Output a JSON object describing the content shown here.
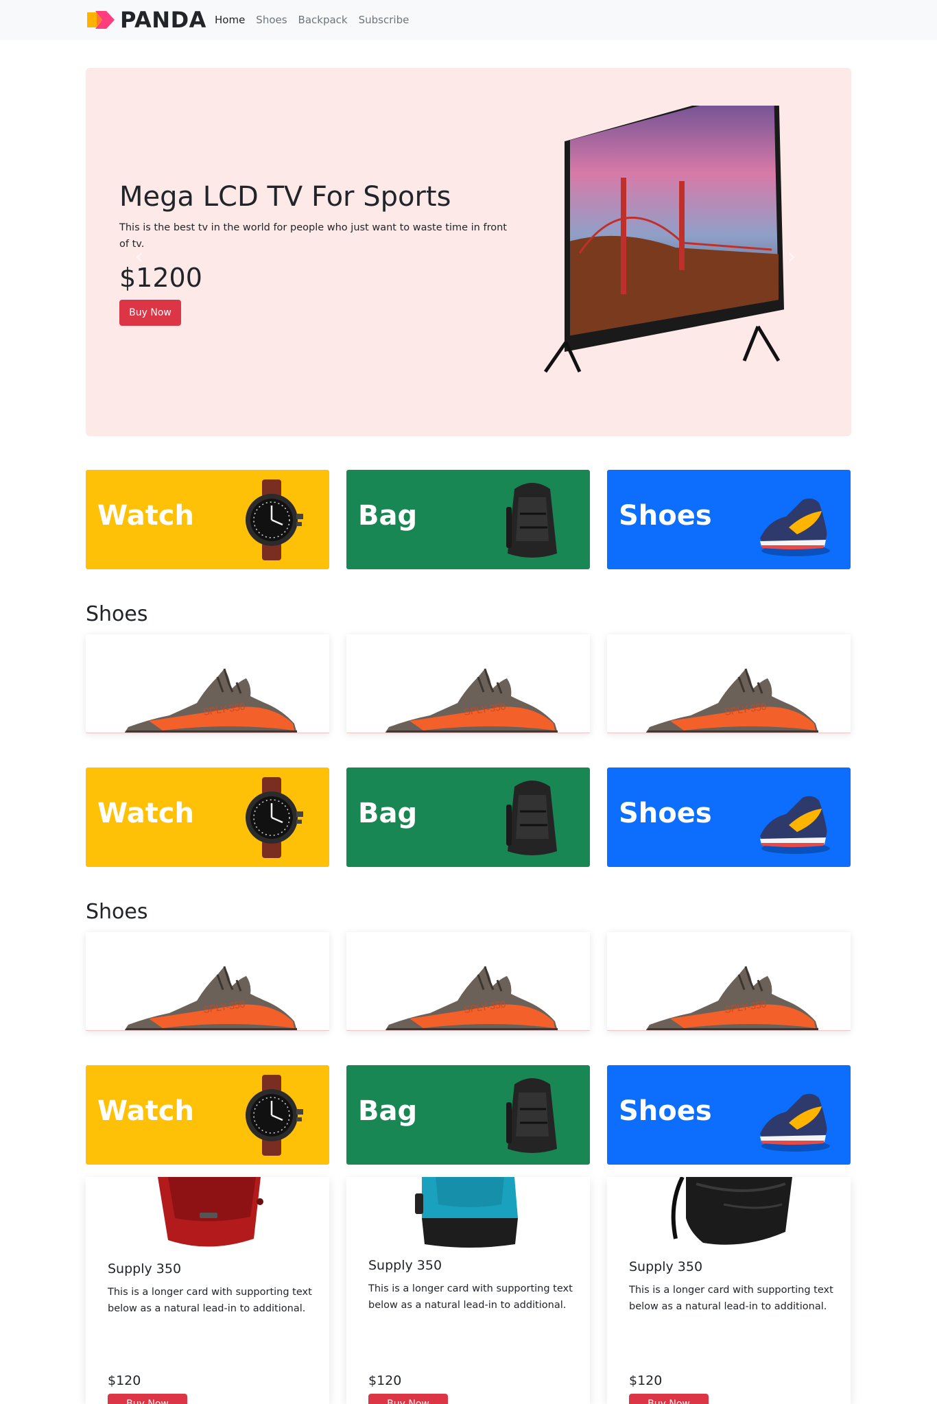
{
  "navbar": {
    "brand": "PANDA",
    "links": [
      {
        "label": "Home",
        "active": true
      },
      {
        "label": "Shoes",
        "active": false
      },
      {
        "label": "Backpack",
        "active": false
      },
      {
        "label": "Subscribe",
        "active": false
      }
    ]
  },
  "hero": {
    "title": "Mega LCD TV For Sports",
    "description": "This is the best tv in the world for people who just want to waste time in front of tv.",
    "price": "$1200",
    "button": "Buy Now",
    "prev_icon": "chevron-left-icon",
    "next_icon": "chevron-right-icon"
  },
  "categories": [
    {
      "label": "Watch",
      "color": "#ffc107",
      "icon": "watch-icon"
    },
    {
      "label": "Bag",
      "color": "#198754",
      "icon": "backpack-icon"
    },
    {
      "label": "Shoes",
      "color": "#0d6efd",
      "icon": "sneaker-icon"
    }
  ],
  "sections": [
    {
      "title": "Shoes"
    },
    {
      "title": "Shoes"
    }
  ],
  "products": [
    {
      "title": "Supply 350",
      "text": "This is a longer card with supporting text below as a natural lead-in to additional.",
      "price": "$120",
      "button": "Buy Now",
      "image": "red-backpack"
    },
    {
      "title": "Supply 350",
      "text": "This is a longer card with supporting text below as a natural lead-in to additional.",
      "price": "$120",
      "button": "Buy Now",
      "image": "blue-backpack"
    },
    {
      "title": "Supply 350",
      "text": "This is a longer card with supporting text below as a natural lead-in to additional.",
      "price": "$120",
      "button": "Buy Now",
      "image": "black-backpack"
    }
  ],
  "colors": {
    "danger": "#dc3545",
    "hero_bg": "#fce9e8",
    "navbar_bg": "#f8f9fa"
  }
}
